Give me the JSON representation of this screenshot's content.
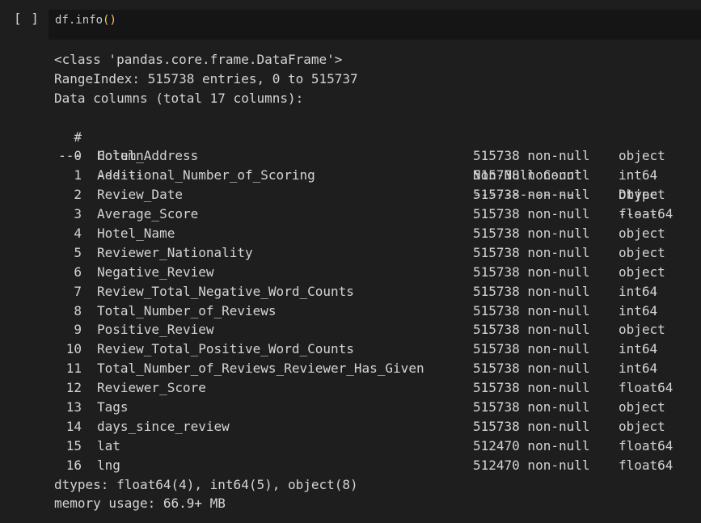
{
  "cell": {
    "run_label": "[ ]",
    "code": {
      "object": "df",
      "dot": ".",
      "method": "info",
      "parens": "()"
    }
  },
  "output": {
    "class_line": "<class 'pandas.core.frame.DataFrame'>",
    "range_index": "RangeIndex: 515738 entries, 0 to 515737",
    "data_columns": "Data columns (total 17 columns):",
    "header": {
      "num": "#",
      "column": "Column",
      "count": "Non-Null Count",
      "dtype": "Dtype"
    },
    "separator": {
      "num": "---",
      "column": "------",
      "count": "--------------",
      "dtype": "-----"
    },
    "rows": [
      {
        "num": "0",
        "column": "Hotel_Address",
        "count": "515738 non-null",
        "dtype": "object"
      },
      {
        "num": "1",
        "column": "Additional_Number_of_Scoring",
        "count": "515738 non-null",
        "dtype": "int64"
      },
      {
        "num": "2",
        "column": "Review_Date",
        "count": "515738 non-null",
        "dtype": "object"
      },
      {
        "num": "3",
        "column": "Average_Score",
        "count": "515738 non-null",
        "dtype": "float64"
      },
      {
        "num": "4",
        "column": "Hotel_Name",
        "count": "515738 non-null",
        "dtype": "object"
      },
      {
        "num": "5",
        "column": "Reviewer_Nationality",
        "count": "515738 non-null",
        "dtype": "object"
      },
      {
        "num": "6",
        "column": "Negative_Review",
        "count": "515738 non-null",
        "dtype": "object"
      },
      {
        "num": "7",
        "column": "Review_Total_Negative_Word_Counts",
        "count": "515738 non-null",
        "dtype": "int64"
      },
      {
        "num": "8",
        "column": "Total_Number_of_Reviews",
        "count": "515738 non-null",
        "dtype": "int64"
      },
      {
        "num": "9",
        "column": "Positive_Review",
        "count": "515738 non-null",
        "dtype": "object"
      },
      {
        "num": "10",
        "column": "Review_Total_Positive_Word_Counts",
        "count": "515738 non-null",
        "dtype": "int64"
      },
      {
        "num": "11",
        "column": "Total_Number_of_Reviews_Reviewer_Has_Given",
        "count": "515738 non-null",
        "dtype": "int64"
      },
      {
        "num": "12",
        "column": "Reviewer_Score",
        "count": "515738 non-null",
        "dtype": "float64"
      },
      {
        "num": "13",
        "column": "Tags",
        "count": "515738 non-null",
        "dtype": "object"
      },
      {
        "num": "14",
        "column": "days_since_review",
        "count": "515738 non-null",
        "dtype": "object"
      },
      {
        "num": "15",
        "column": "lat",
        "count": "512470 non-null",
        "dtype": "float64"
      },
      {
        "num": "16",
        "column": "lng",
        "count": "512470 non-null",
        "dtype": "float64"
      }
    ],
    "dtypes_line": "dtypes: float64(4), int64(5), object(8)",
    "memory_line": "memory usage: 66.9+ MB"
  },
  "colors": {
    "background": "#1e1e1e",
    "editor_background": "#151515",
    "text": "#d4d4d4",
    "paren": "#f9c94a"
  }
}
